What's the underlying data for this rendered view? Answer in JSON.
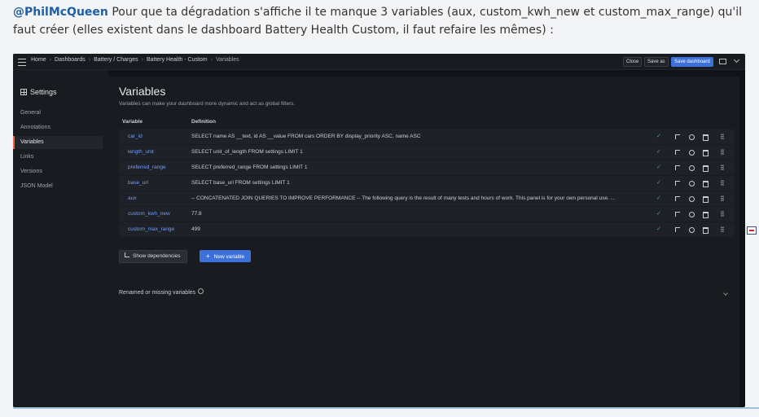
{
  "post": {
    "mention": "@PhilMcQueen",
    "text": " Pour que ta dégradation s'affiche il te manque 3 variables (aux, custom_kwh_new et custom_max_range) qu'il faut créer (elles existent dans le dashboard Battery Health Custom, il faut refaire les mêmes) :"
  },
  "topbar": {
    "breadcrumbs": [
      "Home",
      "Dashboards",
      "Battery / Charges",
      "Battery Health - Custom",
      "Variables"
    ],
    "close_label": "Close",
    "save_as_label": "Save as",
    "save_dashboard_label": "Save dashboard"
  },
  "sidebar": {
    "title": "Settings",
    "items": [
      {
        "label": "General"
      },
      {
        "label": "Annotations"
      },
      {
        "label": "Variables",
        "active": true
      },
      {
        "label": "Links"
      },
      {
        "label": "Versions"
      },
      {
        "label": "JSON Model"
      }
    ]
  },
  "main": {
    "title": "Variables",
    "subtitle": "Variables can make your dashboard more dynamic and act as global filters.",
    "col_variable": "Variable",
    "col_definition": "Definition",
    "rows": [
      {
        "name": "car_id",
        "definition": "SELECT name AS __text, id AS __value FROM cars ORDER BY display_priority ASC, name ASC"
      },
      {
        "name": "length_unit",
        "definition": "SELECT unit_of_length FROM settings LIMIT 1"
      },
      {
        "name": "preferred_range",
        "definition": "SELECT preferred_range FROM settings LIMIT 1"
      },
      {
        "name": "base_url",
        "definition": "SELECT base_url FROM settings LIMIT 1"
      },
      {
        "name": "aux",
        "definition": "-- CONCATENATED JOIN QUERIES TO IMPROVE PERFORMANCE -- The following query is the result of many tests and hours of work. This panel is for your own personal use. ..."
      },
      {
        "name": "custom_kwh_new",
        "definition": "77.8"
      },
      {
        "name": "custom_max_range",
        "definition": "499"
      }
    ],
    "show_dependencies_label": "Show dependencies",
    "new_variable_label": "New variable",
    "renamed_label": "Renamed or missing variables"
  },
  "colors": {
    "accent": "#3d71d9",
    "active_marker": "#f55f3e",
    "variable_name": "#6e9fff",
    "ok": "#3ab66f"
  }
}
